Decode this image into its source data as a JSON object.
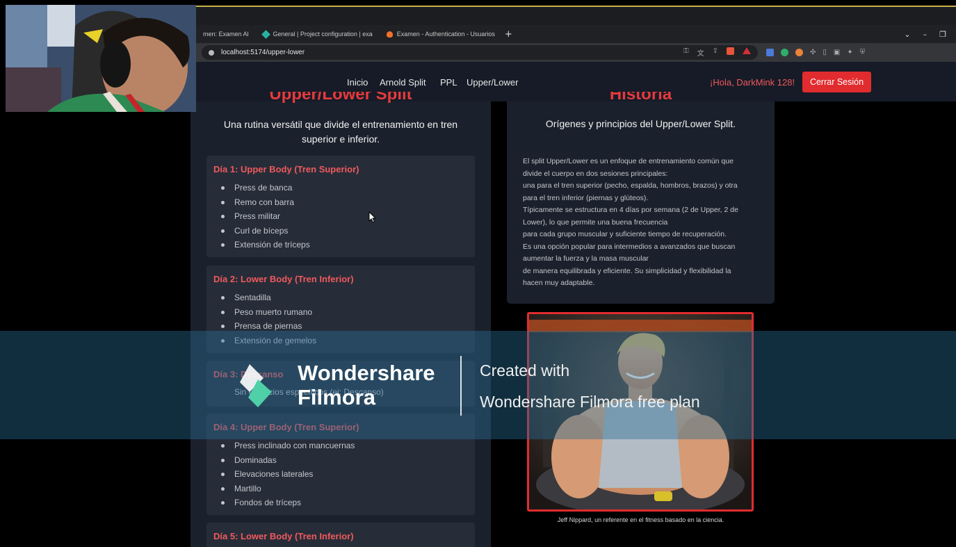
{
  "browser": {
    "tabs": [
      {
        "label": "men: Examen Al",
        "icon": "none"
      },
      {
        "label": "General | Project configuration | exa",
        "icon": "teal-diamond-icon"
      },
      {
        "label": "Examen - Authentication - Usuarios",
        "icon": "firebase-icon"
      }
    ],
    "new_tab": "+",
    "url": "localhost:5174/upper-lower"
  },
  "nav": {
    "links": [
      "Inicio",
      "Arnold Split",
      "PPL",
      "Upper/Lower"
    ],
    "greeting": "¡Hola, DarkMink 128!",
    "logout_label": "Cerrar Sesión",
    "accent": "#e12c2f"
  },
  "left": {
    "title": "Upper/Lower Split",
    "subtitle": "Una rutina versátil que divide el entrenamiento en tren superior e inferior.",
    "days": [
      {
        "title": "Día 1: Upper Body (Tren Superior)",
        "items": [
          "Press de banca",
          "Remo con barra",
          "Press militar",
          "Curl de bíceps",
          "Extensión de tríceps"
        ]
      },
      {
        "title": "Día 2: Lower Body (Tren Inferior)",
        "items": [
          "Sentadilla",
          "Peso muerto rumano",
          "Prensa de piernas",
          "Extensión de gemelos"
        ]
      },
      {
        "title": "Día 3: Descanso",
        "note": "Sin ejercicios específicos (ej: Descanso)"
      },
      {
        "title": "Día 4: Upper Body (Tren Superior)",
        "items": [
          "Press inclinado con mancuernas",
          "Dominadas",
          "Elevaciones laterales",
          "Martillo",
          "Fondos de tríceps"
        ]
      },
      {
        "title": "Día 5: Lower Body (Tren Inferior)"
      }
    ]
  },
  "right": {
    "title": "Historia",
    "subtitle": "Orígenes y principios del Upper/Lower Split.",
    "paragraph_lines": [
      "El split Upper/Lower es un enfoque de entrenamiento común que",
      "divide el cuerpo en dos sesiones principales:",
      "una para el tren superior (pecho, espalda, hombros, brazos) y otra",
      "para el tren inferior (piernas y glúteos).",
      "Típicamente se estructura en 4 días por semana (2 de Upper, 2 de",
      "Lower), lo que permite una buena frecuencia",
      "para cada grupo muscular y suficiente tiempo de recuperación.",
      "Es una opción popular para intermedios a avanzados que buscan",
      "aumentar la fuerza y la masa muscular",
      "de manera equilibrada y eficiente. Su simplicidad y flexibilidad la",
      "hacen muy adaptable."
    ],
    "photo_caption": "Jeff Nippard, un referente en el fitness basado en la ciencia."
  },
  "watermark": {
    "brand_line1": "Wondershare",
    "brand_line2": "Filmora",
    "created_line1": "Created with",
    "created_line2": "Wondershare Filmora free plan"
  }
}
